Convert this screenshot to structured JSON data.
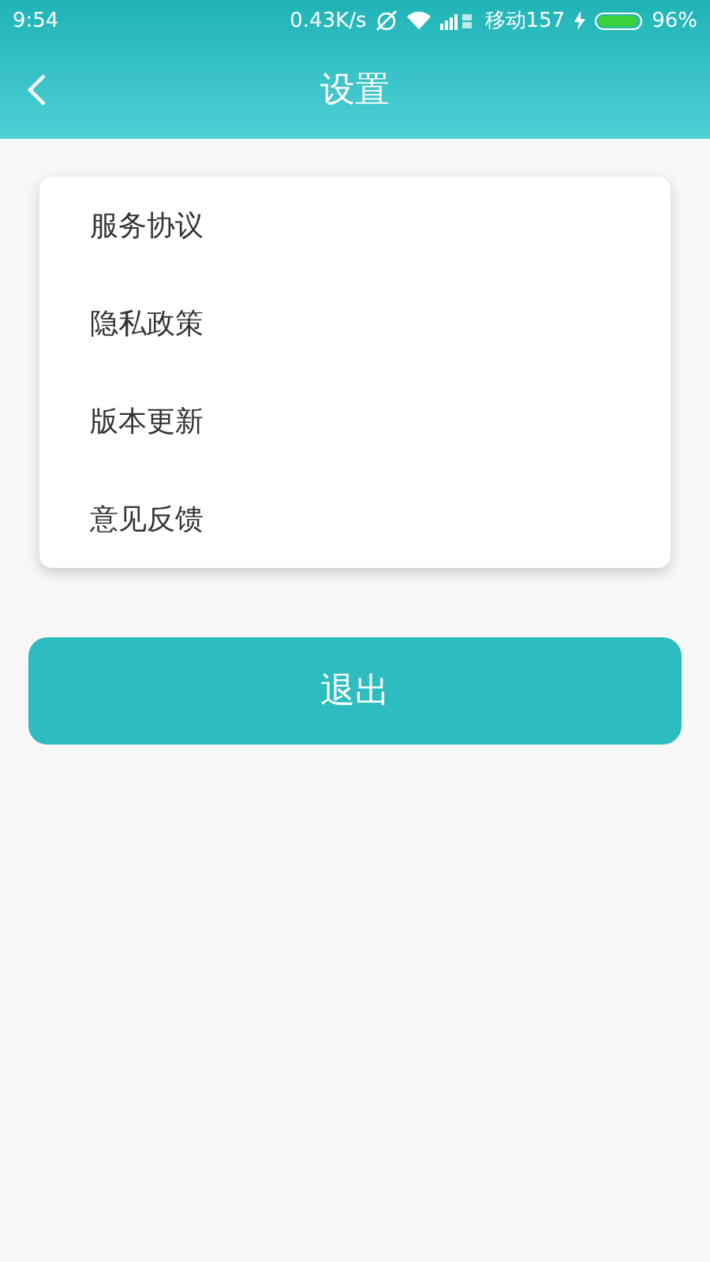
{
  "status_bar": {
    "time": "9:54",
    "speed": "0.43K/s",
    "carrier": "移动157",
    "battery": {
      "level": 0.96
    },
    "battery_text": "96%"
  },
  "toolbar": {
    "title": "设置"
  },
  "menu": [
    {
      "label": "服务协议"
    },
    {
      "label": "隐私政策"
    },
    {
      "label": "版本更新"
    },
    {
      "label": "意见反馈"
    }
  ],
  "logout_button": "退出"
}
